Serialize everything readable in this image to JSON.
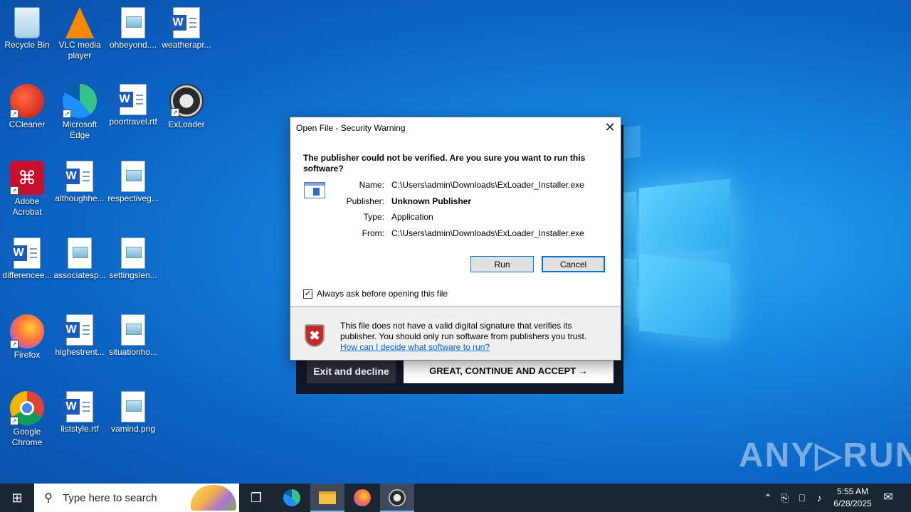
{
  "desktop": {
    "icons": [
      {
        "label": "Recycle Bin"
      },
      {
        "label": "VLC media player"
      },
      {
        "label": "ohbeyond...."
      },
      {
        "label": "weatherapr..."
      },
      {
        "label": "CCleaner"
      },
      {
        "label": "Microsoft Edge"
      },
      {
        "label": "poortravel.rtf"
      },
      {
        "label": "ExLoader"
      },
      {
        "label": "Adobe Acrobat"
      },
      {
        "label": "althoughhe..."
      },
      {
        "label": "respectiveg..."
      },
      {
        "label": "differencee..."
      },
      {
        "label": "associatesp..."
      },
      {
        "label": "settingslen..."
      },
      {
        "label": "Firefox"
      },
      {
        "label": "highestrent..."
      },
      {
        "label": "situationho..."
      },
      {
        "label": "Google Chrome"
      },
      {
        "label": "liststyle.rtf"
      },
      {
        "label": "vamind.png"
      }
    ]
  },
  "banner": {
    "exit_label": "Exit and decline",
    "accept_label": "GREAT, CONTINUE AND ACCEPT  →"
  },
  "dialog": {
    "title": "Open File - Security Warning",
    "close_glyph": "✕",
    "heading": "The publisher could not be verified.  Are you sure you want to run this software?",
    "fields": {
      "name_label": "Name:",
      "name_value": "C:\\Users\\admin\\Downloads\\ExLoader_Installer.exe",
      "publisher_label": "Publisher:",
      "publisher_value": "Unknown Publisher",
      "type_label": "Type:",
      "type_value": "Application",
      "from_label": "From:",
      "from_value": "C:\\Users\\admin\\Downloads\\ExLoader_Installer.exe"
    },
    "run_label": "Run",
    "cancel_label": "Cancel",
    "checkbox_label": "Always ask before opening this file",
    "checkbox_checked": true,
    "checkbox_glyph": "✓",
    "footer_text": "This file does not have a valid digital signature that verifies its publisher.  You should only run software from publishers you trust.",
    "footer_link": "How can I decide what software to run?",
    "shield_glyph": "✖"
  },
  "watermark": "ANY▷RUN",
  "taskbar": {
    "start_glyph": "⊞",
    "search_glyph": "⚲",
    "search_placeholder": "Type here to search",
    "task_view_glyph": "❐",
    "tray_chevron": "⌃",
    "tray_network": "⎕",
    "tray_volume": "♪",
    "notification_glyph": "✉",
    "time": "5:55 AM",
    "date": "6/28/2025"
  },
  "colors": {
    "desktop_bg": "#0b63c4",
    "taskbar_bg": "#1b2633",
    "link": "#0066cc",
    "button_border": "#0078d7"
  }
}
